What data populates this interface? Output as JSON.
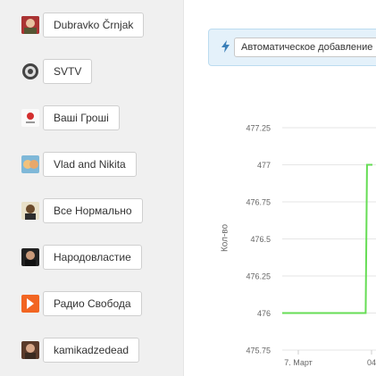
{
  "channels": [
    {
      "label": "Dubravko Črnjak",
      "avatar": "portrait-avatar",
      "color": "#c0392b"
    },
    {
      "label": "SVTV",
      "avatar": "svtv-logo-avatar",
      "color": "#555555"
    },
    {
      "label": "Ваші Гроші",
      "avatar": "money-logo-avatar",
      "color": "#d32f2f"
    },
    {
      "label": "Vlad and Nikita",
      "avatar": "kids-avatar",
      "color": "#e6a86b"
    },
    {
      "label": "Все Нормально",
      "avatar": "portrait-avatar",
      "color": "#6b4a2b"
    },
    {
      "label": "Народовластие",
      "avatar": "portrait-avatar",
      "color": "#3a3a3a"
    },
    {
      "label": "Радио Свобода",
      "avatar": "radio-logo-avatar",
      "color": "#f26522"
    },
    {
      "label": "kamikadzedead",
      "avatar": "portrait-avatar",
      "color": "#7a4a3a"
    }
  ],
  "alert": {
    "icon": "lightning-icon",
    "button_label": "Автоматическое добавление"
  },
  "chart_data": {
    "type": "line",
    "ylabel": "Кол-во",
    "xlabel": "",
    "x_ticks": [
      "7. Март",
      "04"
    ],
    "y_ticks": [
      "477.25",
      "477",
      "476.75",
      "476.5",
      "476.25",
      "476",
      "475.75"
    ],
    "ylim": [
      475.75,
      477.25
    ],
    "series": [
      {
        "color": "#66dd55",
        "points": [
          [
            0,
            476
          ],
          [
            0.925,
            476
          ],
          [
            0.94,
            477
          ],
          [
            1.0,
            477
          ]
        ]
      }
    ]
  }
}
